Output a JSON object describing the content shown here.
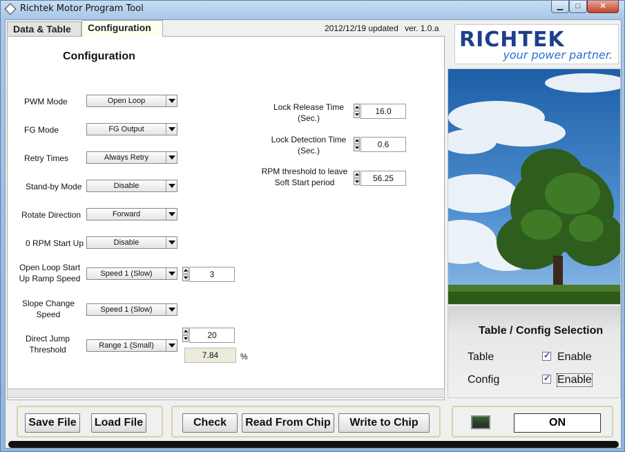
{
  "window": {
    "title": "Richtek Motor Program Tool"
  },
  "tabs": [
    {
      "label": "Data & Table",
      "active": false
    },
    {
      "label": "Configuration",
      "active": true
    }
  ],
  "version": {
    "updated": "2012/12/19 updated",
    "ver": "ver. 1.0.a"
  },
  "config": {
    "title": "Configuration",
    "rows": {
      "pwm_mode": {
        "label": "PWM Mode",
        "value": "Open Loop"
      },
      "fg_mode": {
        "label": "FG Mode",
        "value": "FG Output"
      },
      "retry_times": {
        "label": "Retry Times",
        "value": "Always Retry"
      },
      "standby_mode": {
        "label": "Stand-by Mode",
        "value": "Disable"
      },
      "rotate_direction": {
        "label": "Rotate Direction",
        "value": "Forward"
      },
      "zero_rpm": {
        "label": "0 RPM Start Up",
        "value": "Disable"
      },
      "open_loop_ramp": {
        "label1": "Open Loop Start",
        "label2": "Up Ramp Speed",
        "value": "Speed 1 (Slow)",
        "number": "3"
      },
      "slope_change": {
        "label1": "Slope Change",
        "label2": "Speed",
        "value": "Speed 1 (Slow)"
      },
      "direct_jump": {
        "label1": "Direct Jump",
        "label2": "Threshold",
        "value": "Range 1 (Small)",
        "number": "20",
        "readout": "7.84",
        "unit": "%"
      }
    },
    "right": {
      "lock_release": {
        "label1": "Lock Release Time",
        "label2": "(Sec.)",
        "value": "16.0"
      },
      "lock_detection": {
        "label1": "Lock Detection Time",
        "label2": "(Sec.)",
        "value": "0.6"
      },
      "rpm_threshold": {
        "label1": "RPM threshold to leave",
        "label2": "Soft Start period",
        "value": "56.25"
      }
    }
  },
  "logo": {
    "brand": "RICHTEK",
    "tagline": "your power partner."
  },
  "selection": {
    "title": "Table / Config Selection",
    "table": {
      "label": "Table",
      "enable": "Enable",
      "checked": true
    },
    "config": {
      "label": "Config",
      "enable": "Enable",
      "checked": true
    }
  },
  "buttons": {
    "save_file": "Save File",
    "load_file": "Load File",
    "check": "Check",
    "read_from_chip": "Read From Chip",
    "write_to_chip": "Write to Chip",
    "on": "ON"
  },
  "icons": {
    "title": "app-diamond-icon",
    "minimize": "minimize-icon",
    "maximize": "maximize-icon",
    "close": "close-icon"
  },
  "colors": {
    "brand_blue": "#1e3f8a",
    "tagline_blue": "#2b6fd6",
    "led_green": "#385a38"
  }
}
